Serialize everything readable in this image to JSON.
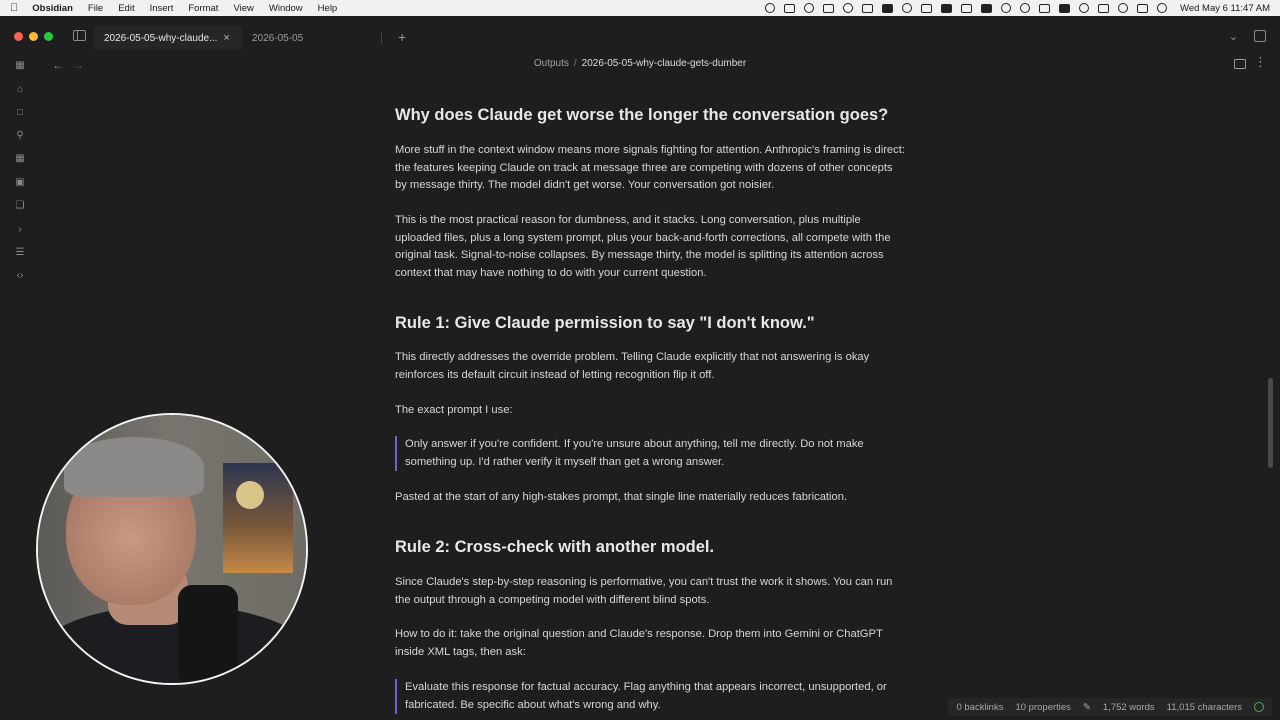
{
  "menubar": {
    "app": "Obsidian",
    "menus": [
      "File",
      "Edit",
      "Insert",
      "Format",
      "View",
      "Window",
      "Help"
    ],
    "clock": "Wed May 6  11:47 AM"
  },
  "tabs": {
    "active_label": "2026-05-05-why-claude...",
    "inactive_label": "2026-05-05",
    "close_glyph": "×",
    "new_tab_glyph": "+"
  },
  "breadcrumb": {
    "folder": "Outputs",
    "separator": "/",
    "file": "2026-05-05-why-claude-gets-dumber"
  },
  "document": {
    "h1": "Why does Claude get worse the longer the conversation goes?",
    "p1": "More stuff in the context window means more signals fighting for attention. Anthropic's framing is direct: the features keeping Claude on track at message three are competing with dozens of other concepts by message thirty. The model didn't get worse. Your conversation got noisier.",
    "p2": "This is the most practical reason for dumbness, and it stacks. Long conversation, plus multiple uploaded files, plus a long system prompt, plus your back-and-forth corrections, all compete with the original task. Signal-to-noise collapses. By message thirty, the model is splitting its attention across context that may have nothing to do with your current question.",
    "h2": "Rule 1: Give Claude permission to say \"I don't know.\"",
    "p3": "This directly addresses the override problem. Telling Claude explicitly that not answering is okay reinforces its default circuit instead of letting recognition flip it off.",
    "p4": "The exact prompt I use:",
    "quote1": "Only answer if you're confident. If you're unsure about anything, tell me directly. Do not make something up. I'd rather verify it myself than get a wrong answer.",
    "p5": "Pasted at the start of any high-stakes prompt, that single line materially reduces fabrication.",
    "h3": "Rule 2: Cross-check with another model.",
    "p6": "Since Claude's step-by-step reasoning is performative, you can't trust the work it shows. You can run the output through a competing model with different blind spots.",
    "p7": "How to do it: take the original question and Claude's response. Drop them into Gemini or ChatGPT inside XML tags, then ask:",
    "quote2": "Evaluate this response for factual accuracy. Flag anything that appears incorrect, unsupported, or fabricated. Be specific about what's wrong and why."
  },
  "statusbar": {
    "backlinks": "0 backlinks",
    "properties": "10 properties",
    "words": "1,752 words",
    "characters": "11,015 characters"
  },
  "colors": {
    "background": "#1e1e1e",
    "blockquote_border": "#7c5bd6",
    "sync_ok": "#4caf50"
  }
}
